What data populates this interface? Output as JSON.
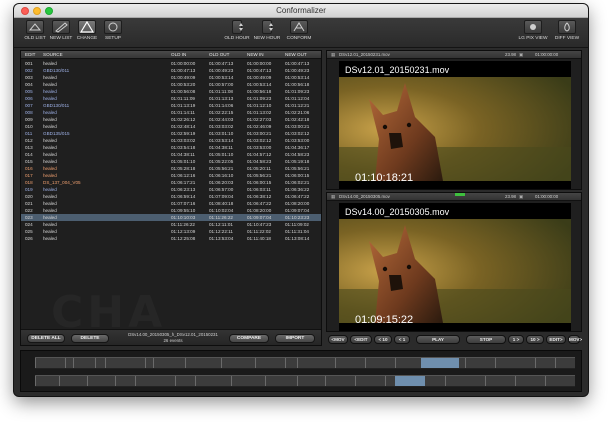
{
  "window": {
    "title": "Conformalizer"
  },
  "toolbar": {
    "left": [
      {
        "label": "OLD LIST",
        "icon": "list-icon"
      },
      {
        "label": "NEW LIST",
        "icon": "pen-icon"
      },
      {
        "label": "CHANGE",
        "icon": "triangle-icon"
      },
      {
        "label": "SETUP",
        "icon": "circle-icon"
      }
    ],
    "center": [
      {
        "label": "OLD HOUR",
        "icon": "hour-stepper-icon"
      },
      {
        "label": "NEW HOUR",
        "icon": "hour-stepper-icon"
      },
      {
        "label": "CONFORM",
        "icon": "conform-icon"
      }
    ],
    "right": [
      {
        "label": "LG PIX VIEW",
        "icon": "picture-icon"
      },
      {
        "label": "DIFF VIEW",
        "icon": "diff-icon"
      }
    ]
  },
  "table": {
    "headers": [
      "EDIT",
      "SOURCE",
      "OLD IN",
      "OLD OUT",
      "NEW IN",
      "NEW OUT"
    ],
    "rows": [
      {
        "edit": "001",
        "source": "healed",
        "old_in": "01:00:00:00",
        "old_out": "01:00:47:13",
        "new_in": "01:00:00:00",
        "new_out": "01:00:47:13"
      },
      {
        "edit": "002",
        "source": "GBD130/011",
        "old_in": "01:00:47:13",
        "old_out": "01:00:49:23",
        "new_in": "01:00:47:13",
        "new_out": "01:00:49:23"
      },
      {
        "edit": "003",
        "source": "healed",
        "old_in": "01:00:49:09",
        "old_out": "01:00:53:14",
        "new_in": "01:00:49:09",
        "new_out": "01:00:53:14"
      },
      {
        "edit": "004",
        "source": "healed",
        "old_in": "01:00:53:20",
        "old_out": "01:00:57:00",
        "new_in": "01:00:53:14",
        "new_out": "01:00:56:18"
      },
      {
        "edit": "005",
        "source": "healed",
        "old_in": "01:00:56:08",
        "old_out": "01:01:11:08",
        "new_in": "01:00:56:18",
        "new_out": "01:01:09:23"
      },
      {
        "edit": "006",
        "source": "healed",
        "old_in": "01:01:11:09",
        "old_out": "01:01:13:13",
        "new_in": "01:01:09:23",
        "new_out": "01:01:12:04"
      },
      {
        "edit": "007",
        "source": "GBD130/011",
        "old_in": "01:01:13:19",
        "old_out": "01:01:14:06",
        "new_in": "01:01:12:10",
        "new_out": "01:01:12:21"
      },
      {
        "edit": "008",
        "source": "healed",
        "old_in": "01:01:14:11",
        "old_out": "01:02:22:15",
        "new_in": "01:01:13:02",
        "new_out": "01:02:21:06"
      },
      {
        "edit": "009",
        "source": "healed",
        "old_in": "01:02:26:12",
        "old_out": "01:02:44:03",
        "new_in": "01:02:27:03",
        "new_out": "01:02:42:18"
      },
      {
        "edit": "010",
        "source": "healed",
        "old_in": "01:02:48:14",
        "old_out": "01:03:03:02",
        "new_in": "01:02:46:09",
        "new_out": "01:03:00:21"
      },
      {
        "edit": "011",
        "source": "GBD135/015",
        "old_in": "01:02:59:19",
        "old_out": "01:03:01:10",
        "new_in": "01:03:00:21",
        "new_out": "01:03:02:12"
      },
      {
        "edit": "012",
        "source": "healed",
        "old_in": "01:03:03:02",
        "old_out": "01:03:53:14",
        "new_in": "01:03:02:12",
        "new_out": "01:03:53:00"
      },
      {
        "edit": "013",
        "source": "healed",
        "old_in": "01:03:54:18",
        "old_out": "01:04:38:11",
        "new_in": "01:03:53:00",
        "new_out": "01:04:36:17"
      },
      {
        "edit": "014",
        "source": "healed",
        "old_in": "01:04:38:11",
        "old_out": "01:05:01:10",
        "new_in": "01:04:57:12",
        "new_out": "01:04:58:23"
      },
      {
        "edit": "015",
        "source": "healed",
        "old_in": "01:05:01:10",
        "old_out": "01:05:22:05",
        "new_in": "01:04:58:23",
        "new_out": "01:05:19:18"
      },
      {
        "edit": "016",
        "source": "healed",
        "old_in": "01:05:28:18",
        "old_out": "01:05:56:21",
        "new_in": "01:05:20:11",
        "new_out": "01:05:56:21"
      },
      {
        "edit": "017",
        "source": "healed",
        "old_in": "01:06:12:16",
        "old_out": "01:06:16:10",
        "new_in": "01:05:56:21",
        "new_out": "01:06:00:15"
      },
      {
        "edit": "018",
        "source": "DS_137_004_V05",
        "old_in": "01:06:17:21",
        "old_out": "01:06:20:03",
        "new_in": "01:06:00:15",
        "new_out": "01:06:02:21"
      },
      {
        "edit": "019",
        "source": "healed",
        "old_in": "01:06:23:13",
        "old_out": "01:06:57:00",
        "new_in": "01:06:03:11",
        "new_out": "01:06:36:22"
      },
      {
        "edit": "020",
        "source": "healed",
        "old_in": "01:06:59:14",
        "old_out": "01:07:09:04",
        "new_in": "01:06:38:12",
        "new_out": "01:06:47:22"
      },
      {
        "edit": "021",
        "source": "healed",
        "old_in": "01:07:07:16",
        "old_out": "01:08:40:18",
        "new_in": "01:06:47:22",
        "new_out": "01:08:20:00"
      },
      {
        "edit": "022",
        "source": "healed",
        "old_in": "01:09:55:10",
        "old_out": "01:10:02:04",
        "new_in": "01:08:20:00",
        "new_out": "01:09:07:04"
      },
      {
        "edit": "023",
        "source": "healed",
        "old_in": "01:10:10:03",
        "old_out": "01:11:26:22",
        "new_in": "01:09:07:04",
        "new_out": "01:10:23:23"
      },
      {
        "edit": "024",
        "source": "healed",
        "old_in": "01:11:26:22",
        "old_out": "01:12:11:01",
        "new_in": "01:10:47:23",
        "new_out": "01:11:09:02"
      },
      {
        "edit": "025",
        "source": "healed",
        "old_in": "01:12:13:09",
        "old_out": "01:12:22:11",
        "new_in": "01:11:22:02",
        "new_out": "01:11:31:04"
      },
      {
        "edit": "026",
        "source": "healed",
        "old_in": "01:12:25:08",
        "old_out": "01:13:53:04",
        "new_in": "01:11:40:18",
        "new_out": "01:13:08:14"
      }
    ]
  },
  "list_footer": {
    "delete_all": "DELETE ALL",
    "delete": "DELETE",
    "summary_line1": "DSv14.00_20150305_h_DSv12.01_20150231",
    "summary_line2": "26 events",
    "compare": "COMPARE",
    "import": "IMPORT"
  },
  "viewer_top": {
    "filename": "DSv12.01_20150231.mov",
    "fps": "23.98",
    "header_tc": "01:00:00:00",
    "overlay_title": "DSv12.01_20150231.mov",
    "timecode": "01:10:18:21"
  },
  "viewer_bottom": {
    "filename": "DSv14.00_20150305.mov",
    "fps": "23.98",
    "header_tc": "01:00:00:00",
    "overlay_title": "DSv14.00_20150305.mov",
    "timecode": "01:09:15:22"
  },
  "transport": {
    "prev_mov": "<MOV",
    "prev_edit": "<EDIT",
    "back10": "< 10",
    "back1": "< 1",
    "play": "PLAY",
    "stop": "STOP",
    "fwd1": "1 >",
    "fwd10": "10 >",
    "next_edit": "EDIT>",
    "next_mov": "MOV>"
  },
  "watermark": "CHA",
  "colors": {
    "selected_row": "#4c5e70",
    "blue_text": "#9fb2e8",
    "orange_text": "#f0a070",
    "timeline_highlight": "#6f8fae"
  }
}
